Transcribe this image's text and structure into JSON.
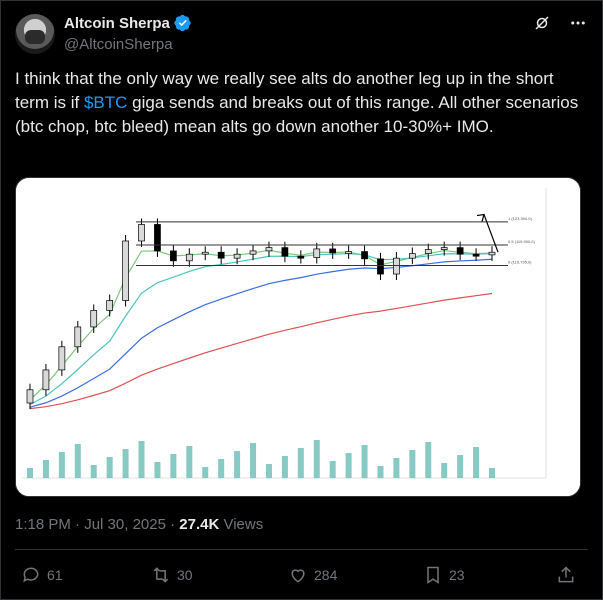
{
  "author": {
    "display_name": "Altcoin Sherpa",
    "handle": "@AltcoinSherpa"
  },
  "tweet": {
    "text_before": "I think that the only way we really see alts do another leg up in the short term is if ",
    "cashtag": "$BTC",
    "text_after": " giga sends and breaks out of this range. All other scenarios (btc chop, btc bleed) mean alts go down another 10-30%+ IMO."
  },
  "meta": {
    "time": "1:18 PM",
    "separator": " · ",
    "date": "Jul 30, 2025",
    "views_count": "27.4K",
    "views_label": " Views"
  },
  "actions": {
    "replies": "61",
    "reposts": "30",
    "likes": "284",
    "bookmarks": "23"
  },
  "icons": {
    "verified": "verified-badge-icon",
    "grok": "grok-icon",
    "more": "more-icon",
    "reply": "reply-icon",
    "repost": "repost-icon",
    "like": "heart-icon",
    "bookmark": "bookmark-icon",
    "share": "share-icon"
  },
  "colors": {
    "accent": "#1d9bf0",
    "candle_up": "#d9d9d9",
    "candle_down": "#000000",
    "ema_green": "#7dc87d",
    "ema_cyan": "#4fc3c3",
    "ema_blue": "#3b6fe0",
    "ema_red": "#e05050",
    "volume": "#5fb8b0"
  },
  "chart_data": {
    "type": "line",
    "title": "",
    "levels": [
      {
        "label": "1 (123,394.0)",
        "value": 123394
      },
      {
        "label": "0.5 (119,900.0)",
        "value": 119900
      },
      {
        "label": "0 (116,795.0)",
        "value": 116795
      }
    ],
    "price_series": [
      98000,
      101000,
      104500,
      107500,
      110000,
      111500,
      120500,
      123000,
      119000,
      117500,
      118500,
      118800,
      117900,
      118500,
      119000,
      119500,
      118200,
      118000,
      119300,
      118700,
      118900,
      117800,
      115500,
      117900,
      118600,
      119200,
      119500,
      118500,
      118400,
      118800
    ],
    "projection": [
      118800,
      124500
    ],
    "ylim": [
      96000,
      127000
    ]
  }
}
